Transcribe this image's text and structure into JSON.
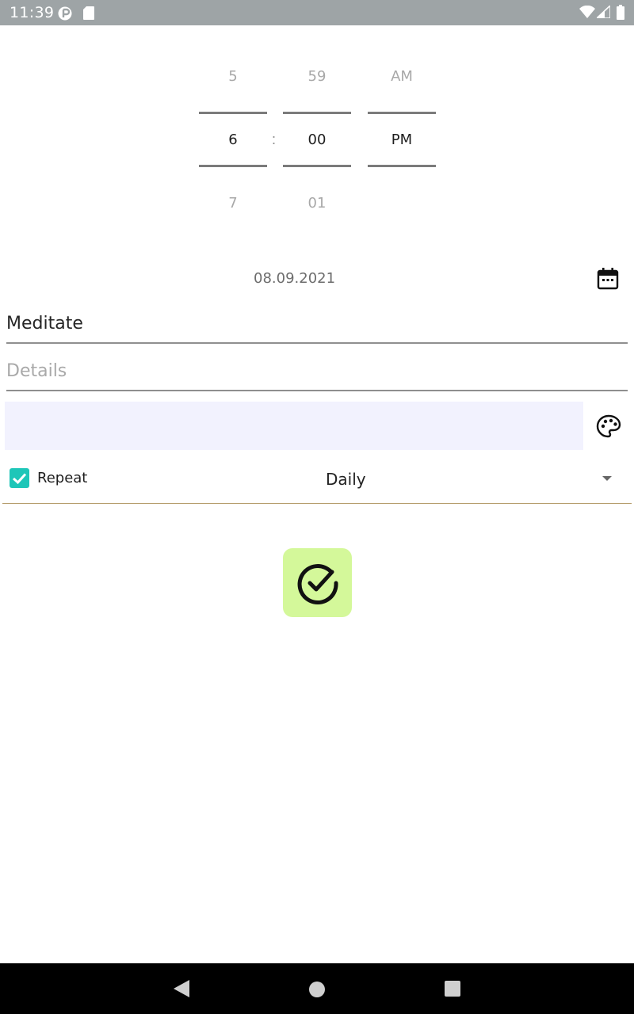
{
  "status_bar": {
    "time": "11:39",
    "icons": [
      "app-notification-icon",
      "sd-card-icon",
      "wifi-icon",
      "cell-signal-icon",
      "battery-icon"
    ]
  },
  "time_picker": {
    "hour": {
      "prev": "5",
      "current": "6",
      "next": "7"
    },
    "separator": ":",
    "minute": {
      "prev": "59",
      "current": "00",
      "next": "01"
    },
    "period": {
      "prev": "AM",
      "current": "PM"
    }
  },
  "date": {
    "value": "08.09.2021",
    "icon": "calendar-icon"
  },
  "title_field": {
    "value": "Meditate"
  },
  "details_field": {
    "value": "",
    "placeholder": "Details"
  },
  "color": {
    "selected": "#f2f2fe",
    "icon": "palette-icon"
  },
  "repeat": {
    "checked": true,
    "label": "Repeat",
    "frequency": "Daily"
  },
  "confirm": {
    "icon": "check-circle-icon",
    "accent": "#d4f89a"
  },
  "colors": {
    "status_bar": "#9ea4a6",
    "checkbox": "#1ec6b8",
    "dropdown_underline": "#b59c6c"
  }
}
